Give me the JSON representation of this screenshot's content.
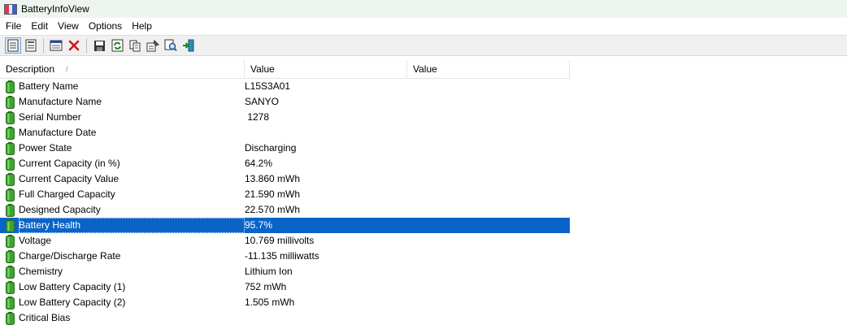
{
  "window": {
    "title": "BatteryInfoView"
  },
  "menu": [
    "File",
    "Edit",
    "View",
    "Options",
    "Help"
  ],
  "toolbar": {
    "buttons": [
      {
        "name": "view-list-icon",
        "pressed": true
      },
      {
        "name": "view-report-icon",
        "pressed": false
      },
      {
        "sep": true
      },
      {
        "name": "properties-window-icon",
        "pressed": false
      },
      {
        "name": "delete-icon",
        "pressed": false
      },
      {
        "sep": true
      },
      {
        "name": "save-icon",
        "pressed": false
      },
      {
        "name": "refresh-icon",
        "pressed": false
      },
      {
        "name": "copy-icon",
        "pressed": false
      },
      {
        "name": "properties-icon",
        "pressed": false
      },
      {
        "name": "find-icon",
        "pressed": false
      },
      {
        "name": "exit-icon",
        "pressed": false
      }
    ]
  },
  "table": {
    "columns": [
      "Description",
      "Value",
      "Value"
    ],
    "sort_indicator": "/",
    "rows": [
      {
        "desc": "Battery Name",
        "value": "L15S3A01"
      },
      {
        "desc": "Manufacture Name",
        "value": "SANYO"
      },
      {
        "desc": "Serial Number",
        "value": " 1278"
      },
      {
        "desc": "Manufacture Date",
        "value": ""
      },
      {
        "desc": "Power State",
        "value": "Discharging"
      },
      {
        "desc": "Current Capacity (in %)",
        "value": "64.2%"
      },
      {
        "desc": "Current Capacity Value",
        "value": "13.860 mWh"
      },
      {
        "desc": "Full Charged Capacity",
        "value": "21.590 mWh"
      },
      {
        "desc": "Designed Capacity",
        "value": "22.570 mWh"
      },
      {
        "desc": "Battery Health",
        "value": "95.7%",
        "selected": true
      },
      {
        "desc": "Voltage",
        "value": "10.769 millivolts"
      },
      {
        "desc": "Charge/Discharge Rate",
        "value": "-11.135 milliwatts"
      },
      {
        "desc": "Chemistry",
        "value": "Lithium Ion"
      },
      {
        "desc": "Low Battery Capacity (1)",
        "value": "752 mWh"
      },
      {
        "desc": "Low Battery Capacity (2)",
        "value": "1.505 mWh"
      },
      {
        "desc": "Critical Bias",
        "value": ""
      }
    ]
  },
  "colors": {
    "selection": "#0a64c8",
    "battery_green": "#3aa630"
  }
}
